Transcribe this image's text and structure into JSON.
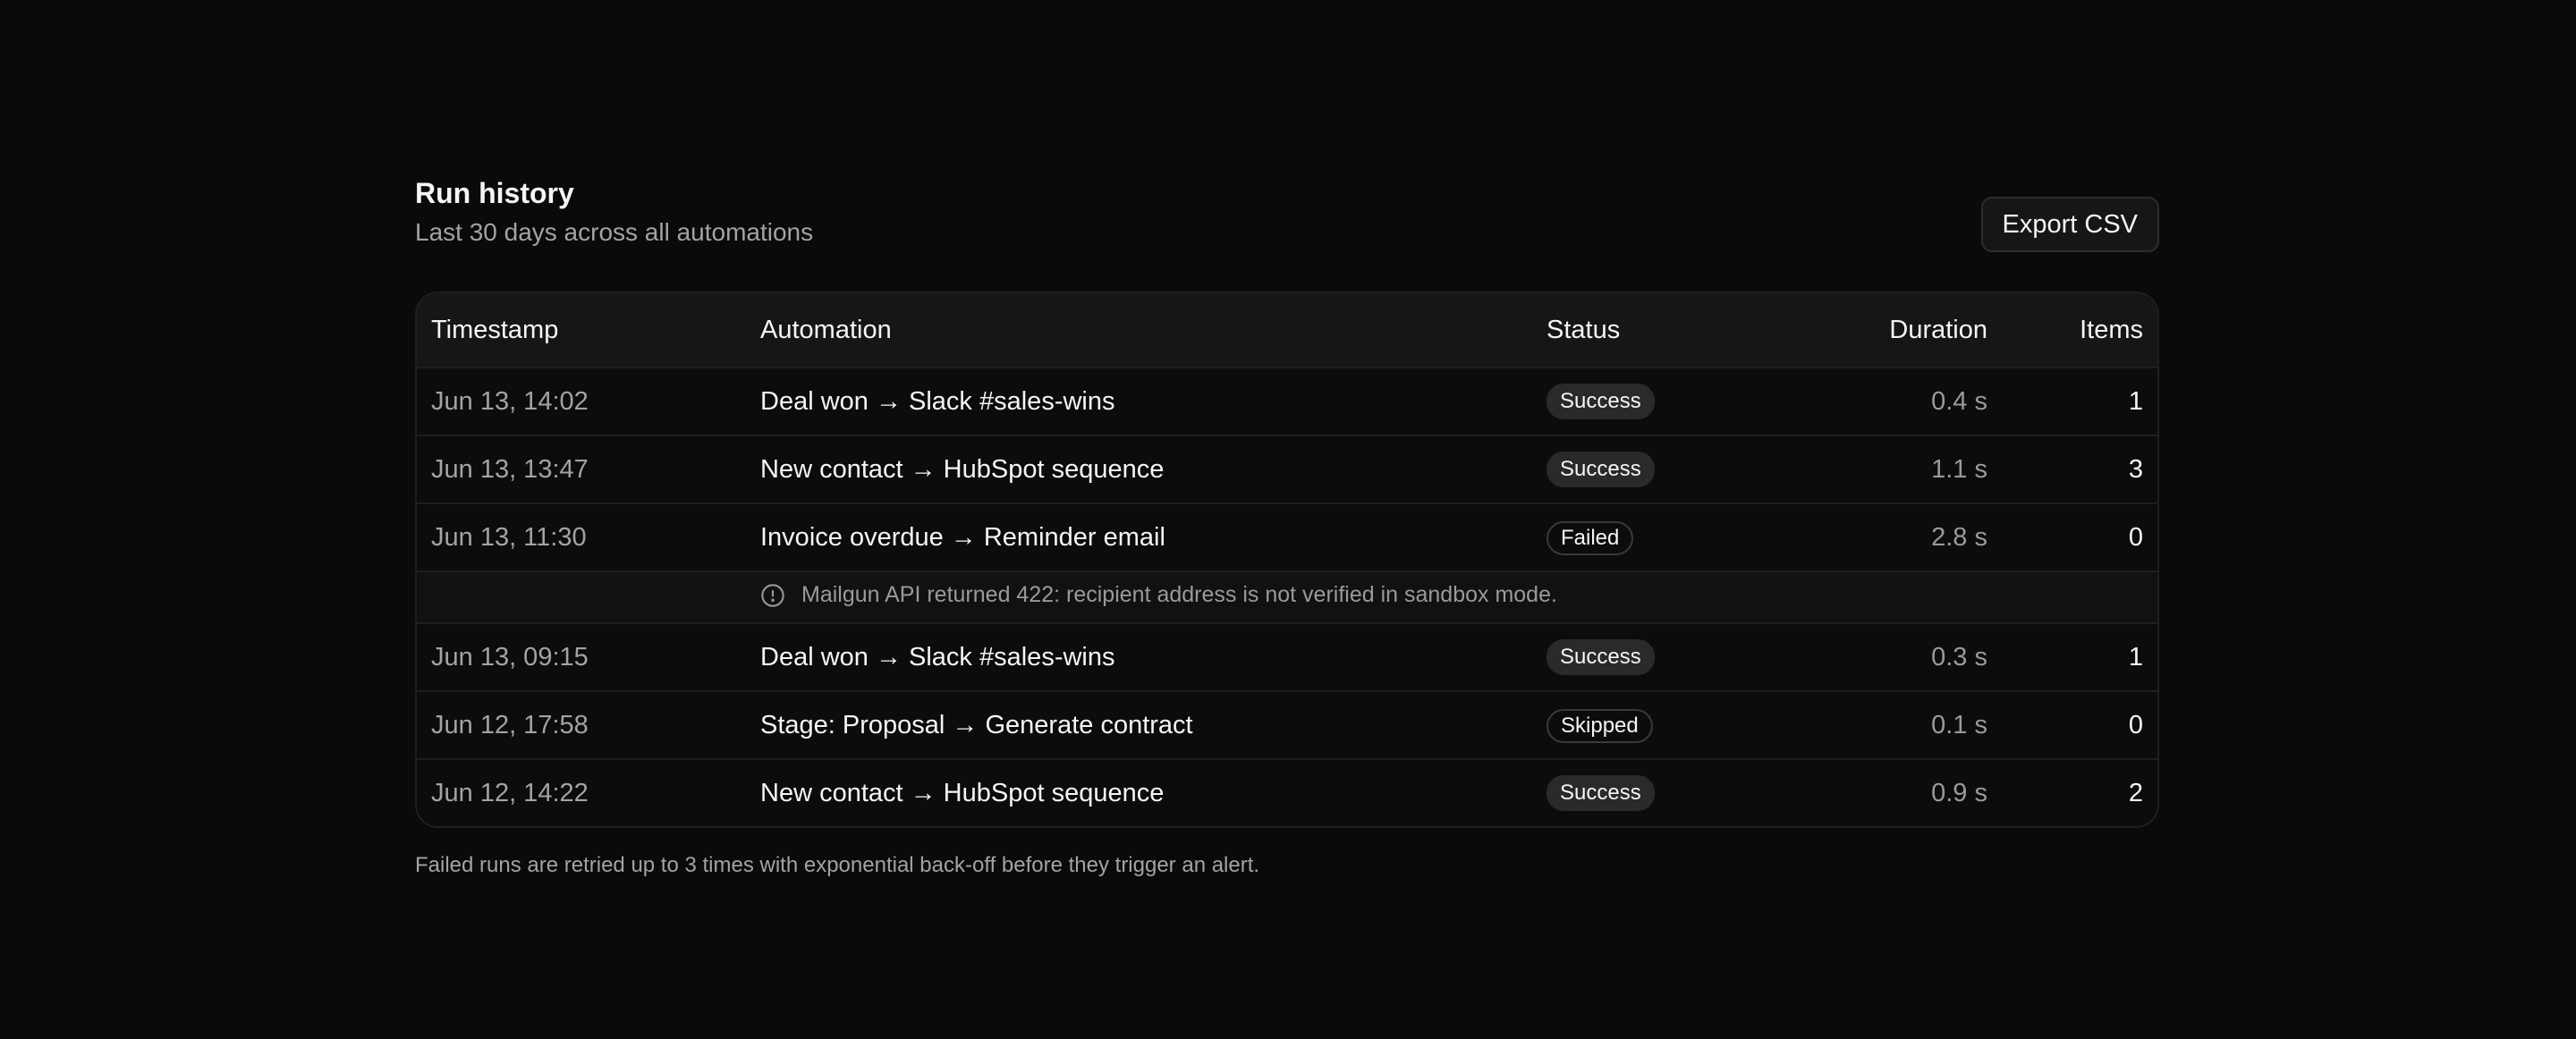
{
  "header": {
    "title": "Run history",
    "subtitle": "Last 30 days across all automations",
    "export_label": "Export CSV"
  },
  "table": {
    "columns": {
      "timestamp": "Timestamp",
      "automation": "Automation",
      "status": "Status",
      "duration": "Duration",
      "items": "Items"
    },
    "rows": [
      {
        "timestamp": "Jun 13, 14:02",
        "automation": "Deal won → Slack #sales-wins",
        "status": "Success",
        "duration": "0.4 s",
        "items": "1"
      },
      {
        "timestamp": "Jun 13, 13:47",
        "automation": "New contact → HubSpot sequence",
        "status": "Success",
        "duration": "1.1 s",
        "items": "3"
      },
      {
        "timestamp": "Jun 13, 11:30",
        "automation": "Invoice overdue → Reminder email",
        "status": "Failed",
        "duration": "2.8 s",
        "items": "0"
      },
      {
        "timestamp": "Jun 13, 09:15",
        "automation": "Deal won → Slack #sales-wins",
        "status": "Success",
        "duration": "0.3 s",
        "items": "1"
      },
      {
        "timestamp": "Jun 12, 17:58",
        "automation": "Stage: Proposal → Generate contract",
        "status": "Skipped",
        "duration": "0.1 s",
        "items": "0"
      },
      {
        "timestamp": "Jun 12, 14:22",
        "automation": "New contact → HubSpot sequence",
        "status": "Success",
        "duration": "0.9 s",
        "items": "2"
      }
    ],
    "error_message": "Mailgun API returned 422: recipient address is not verified in sandbox mode."
  },
  "footnote": "Failed runs are retried up to 3 times with exponential back-off before they trigger an alert.",
  "icons": {
    "error": "info-circle-icon"
  }
}
